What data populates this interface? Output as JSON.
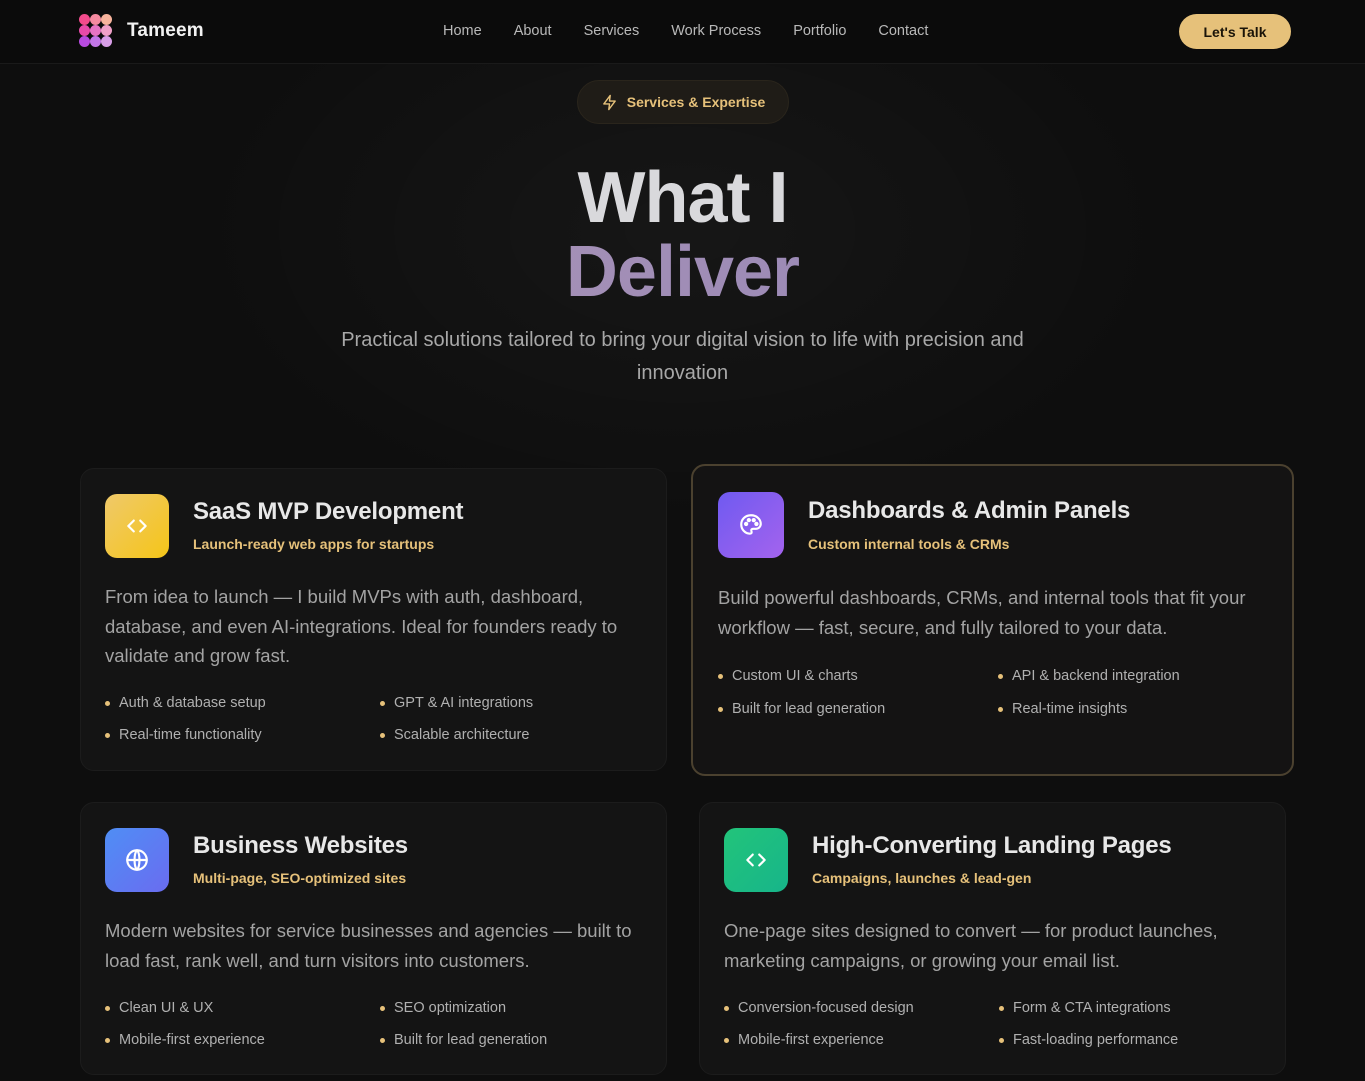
{
  "nav": {
    "brand": "Tameem",
    "links": [
      "Home",
      "About",
      "Services",
      "Work Process",
      "Portfolio",
      "Contact"
    ],
    "cta": "Let's Talk"
  },
  "hero": {
    "pill": "Services & Expertise",
    "title_line1": "What I",
    "title_line2": "Deliver",
    "subtitle": "Practical solutions tailored to bring your digital vision to life with precision and innovation"
  },
  "cards": [
    {
      "title": "SaaS MVP Development",
      "subtitle": "Launch-ready web apps for startups",
      "description": "From idea to launch — I build MVPs with auth, dashboard, database, and even AI-integrations. Ideal for founders ready to validate and grow fast.",
      "features": [
        "Auth & database setup",
        "GPT & AI integrations",
        "Real-time functionality",
        "Scalable architecture"
      ],
      "icon": "code-icon",
      "color": "#f3c344"
    },
    {
      "title": "Dashboards & Admin Panels",
      "subtitle": "Custom internal tools & CRMs",
      "description": "Build powerful dashboards, CRMs, and internal tools that fit your workflow — fast, secure, and fully tailored to your data.",
      "features": [
        "Custom UI & charts",
        "API & backend integration",
        "Built for lead generation",
        "Real-time insights"
      ],
      "icon": "palette-icon",
      "color": "#8e5cf0"
    },
    {
      "title": "Business Websites",
      "subtitle": "Multi-page, SEO-optimized sites",
      "description": "Modern websites for service businesses and agencies — built to load fast, rank well, and turn visitors into customers.",
      "features": [
        "Clean UI & UX",
        "SEO optimization",
        "Mobile-first experience",
        "Built for lead generation"
      ],
      "icon": "globe-icon",
      "color": "#5b7ff5"
    },
    {
      "title": "High-Converting Landing Pages",
      "subtitle": "Campaigns, launches & lead-gen",
      "description": "One-page sites designed to convert — for product launches, marketing campaigns, or growing your email list.",
      "features": [
        "Conversion-focused design",
        "Form & CTA integrations",
        "Mobile-first experience",
        "Fast-loading performance"
      ],
      "icon": "code-icon",
      "color": "#22c47a"
    }
  ]
}
